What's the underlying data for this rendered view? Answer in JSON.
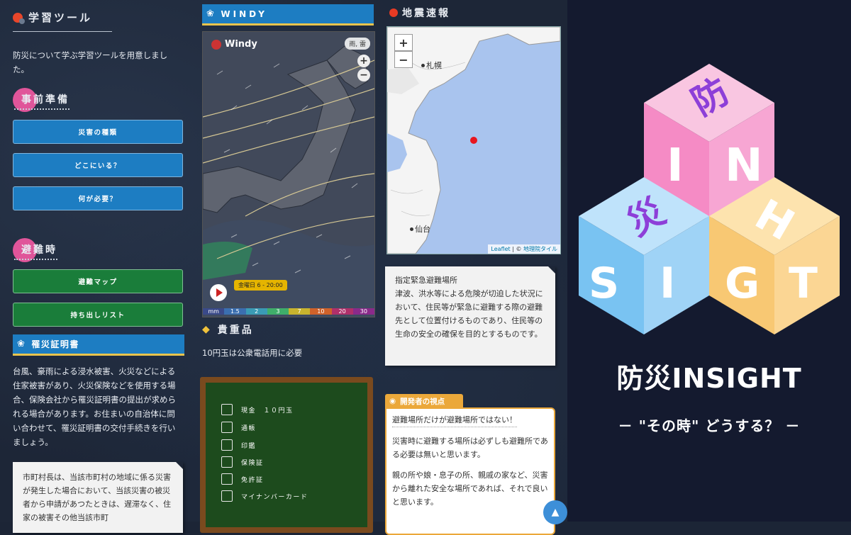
{
  "learning": {
    "title": "学習ツール",
    "intro": "防災について学ぶ学習ツールを用意しました。",
    "prep_title": "事前準備",
    "prep_buttons": [
      "災害の種類",
      "どこにいる？",
      "何が必要？"
    ],
    "evac_title": "避難時",
    "evac_buttons": [
      "避難マップ",
      "持ち出しリスト"
    ],
    "cert_title": "罹災証明書",
    "cert_text": "台風、豪雨による浸水被害、火災などによる住家被害があり、火災保険などを使用する場合、保険会社から罹災証明書の提出が求められる場合があります。お住まいの自治体に問い合わせて、罹災証明書の交付手続きを行いましょう。",
    "law_note": "市町村長は、当該市町村の地域に係る災害が発生した場合において、当該災害の被災者から申請があつたときは、遅滞なく、住家の被害その他当該市町"
  },
  "windy": {
    "title": "WINDY",
    "logo": "Windy",
    "layer": "雨, 雷",
    "time": "金曜日 6 - 20:00",
    "scale": [
      "mm",
      "1.5",
      "2",
      "3",
      "7",
      "10",
      "20",
      "30"
    ]
  },
  "valuables": {
    "title": "貴重品",
    "text": "10円玉は公衆電話用に必要",
    "items": [
      "現金　１０円玉",
      "通帳",
      "印鑑",
      "保険証",
      "免許証",
      "マイナンバーカード"
    ]
  },
  "earthquake": {
    "title": "地震速報",
    "zoom_in": "+",
    "zoom_out": "−",
    "cities": [
      "札幌",
      "仙台"
    ],
    "attribution_leaflet": "Leaflet",
    "attribution_sep": " | © ",
    "attribution_tile": "地理院タイル",
    "shelter_note": "指定緊急避難場所\n津波、洪水等による危険が切迫した状況において、住民等が緊急に避難する際の避難先として位置付けるものであり、住民等の生命の安全の確保を目的とするものです。"
  },
  "developer": {
    "tag": "開発者の視点",
    "line1": "避難場所だけが避難場所ではない！",
    "line2": "災害時に避難する場所は必ずしも避難所である必要は無いと思います。",
    "line3": "親の所や娘・息子の所、親戚の家など、災害から離れた安全な場所であれば、それで良いと思います。"
  },
  "brand": {
    "logo_chars": [
      "防",
      "I",
      "N",
      "災",
      "H",
      "S",
      "I",
      "G",
      "T"
    ],
    "title": "防災INSIGHT",
    "subtitle": "－ \"その時\" どうする？ －"
  },
  "colors": {
    "bar_blue": "#1d7dc2",
    "btn_green": "#1a7d3a",
    "accent_pink": "#e0559a",
    "accent_orange": "#eba83a"
  }
}
